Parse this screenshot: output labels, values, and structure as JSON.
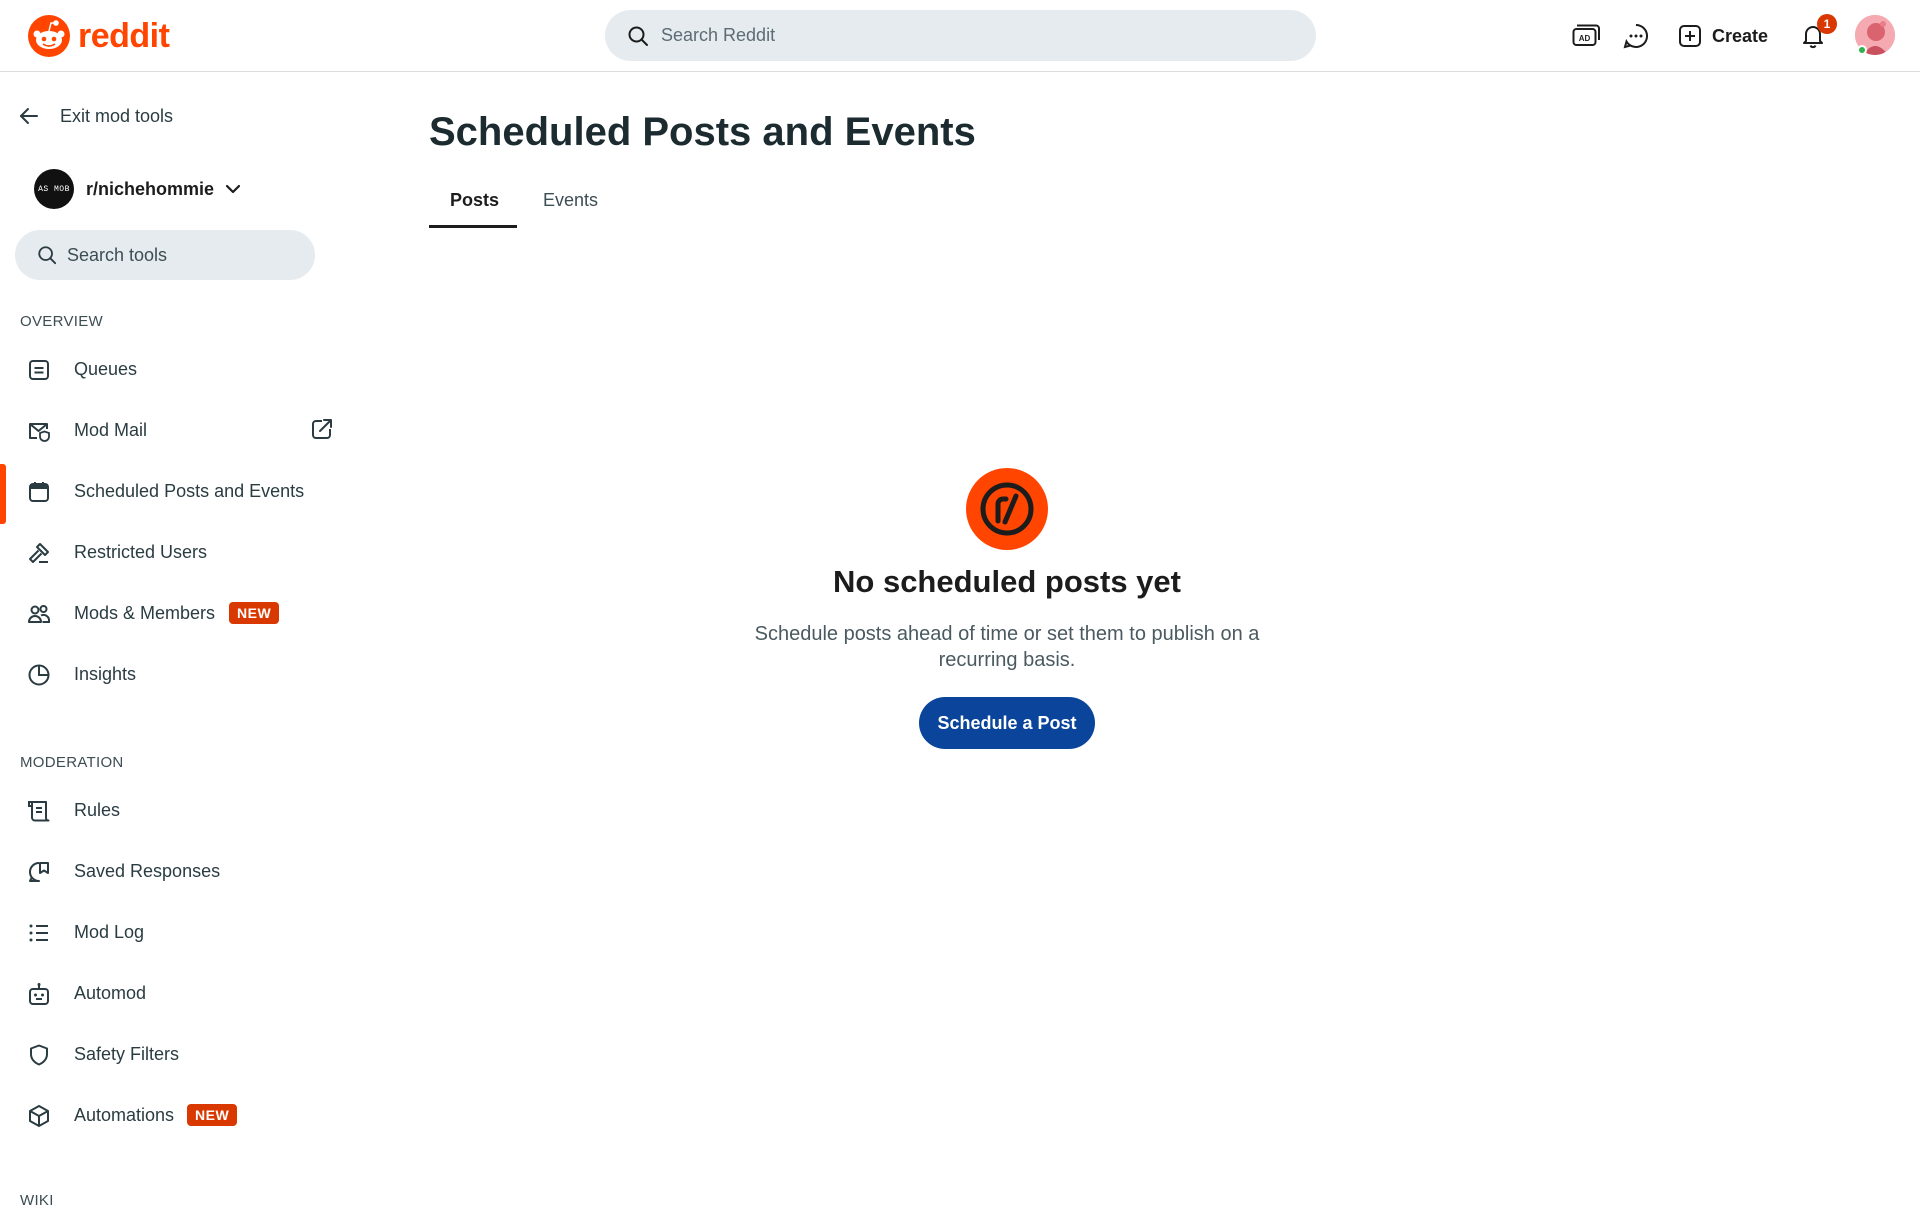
{
  "header": {
    "brand": "reddit",
    "search_placeholder": "Search Reddit",
    "create_label": "Create",
    "notification_count": "1",
    "brand_color": "#ff4500"
  },
  "sidebar": {
    "exit_label": "Exit mod tools",
    "community_name": "r/nichehommie",
    "community_avatar_text": "AS MOB",
    "tool_search_placeholder": "Search tools",
    "overview_header": "OVERVIEW",
    "overview_items": [
      {
        "label": "Queues",
        "icon": "queue-icon"
      },
      {
        "label": "Mod Mail",
        "icon": "mail-icon",
        "external": true
      },
      {
        "label": "Scheduled Posts and Events",
        "icon": "calendar-icon",
        "active": true
      },
      {
        "label": "Restricted Users",
        "icon": "gavel-icon"
      },
      {
        "label": "Mods & Members",
        "icon": "members-icon",
        "badge": "NEW"
      },
      {
        "label": "Insights",
        "icon": "pie-chart-icon"
      }
    ],
    "moderation_header": "MODERATION",
    "moderation_items": [
      {
        "label": "Rules",
        "icon": "scroll-icon"
      },
      {
        "label": "Saved Responses",
        "icon": "saved-response-icon"
      },
      {
        "label": "Mod Log",
        "icon": "list-icon"
      },
      {
        "label": "Automod",
        "icon": "robot-icon"
      },
      {
        "label": "Safety Filters",
        "icon": "shield-icon"
      },
      {
        "label": "Automations",
        "icon": "cube-icon",
        "badge": "NEW"
      }
    ],
    "next_header_peek": "WIKI"
  },
  "main": {
    "title": "Scheduled Posts and Events",
    "tabs": [
      {
        "label": "Posts",
        "active": true
      },
      {
        "label": "Events",
        "active": false
      }
    ],
    "empty_state": {
      "title": "No scheduled posts yet",
      "description": "Schedule posts ahead of time or set them to publish on a recurring basis.",
      "button_label": "Schedule a Post"
    }
  },
  "colors": {
    "accent": "#ff4500",
    "primary_button": "#0a449b",
    "badge": "#d93900"
  }
}
